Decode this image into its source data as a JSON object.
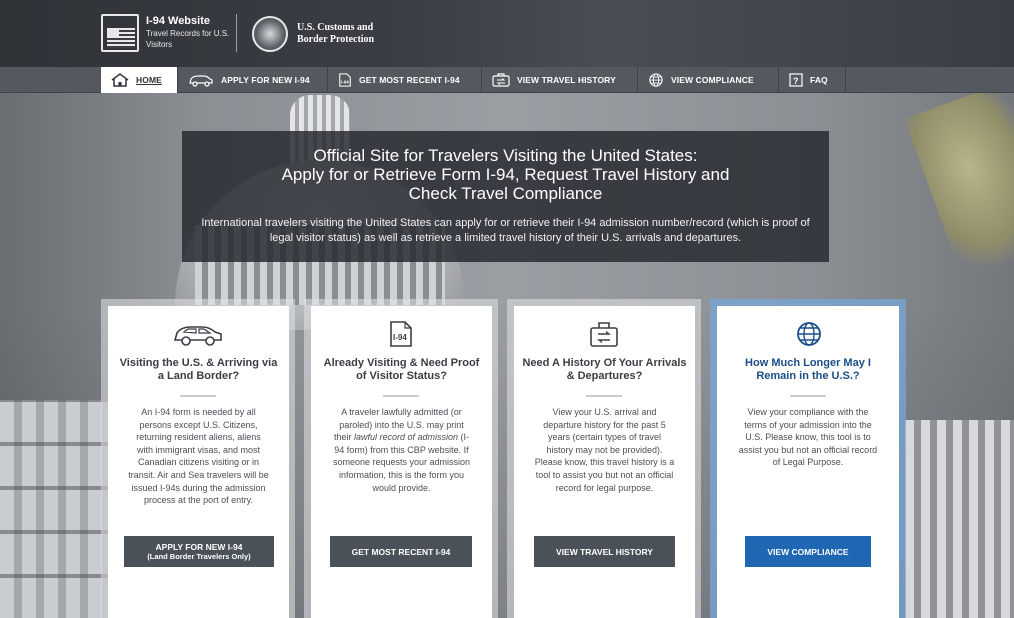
{
  "header": {
    "brand_title": "I-94 Website",
    "brand_sub": "Travel Records for U.S. Visitors",
    "agency_name": "U.S. Customs and Border Protection"
  },
  "nav": {
    "items": [
      {
        "label": "HOME",
        "icon": "home-icon",
        "active": true
      },
      {
        "label": "APPLY FOR NEW I-94",
        "icon": "car-icon"
      },
      {
        "label": "GET MOST RECENT I-94",
        "icon": "i94-document-icon"
      },
      {
        "label": "VIEW TRAVEL HISTORY",
        "icon": "travel-history-icon"
      },
      {
        "label": "VIEW COMPLIANCE",
        "icon": "globe-icon"
      },
      {
        "label": "FAQ",
        "icon": "question-icon"
      }
    ]
  },
  "hero": {
    "title": "Official Site for Travelers Visiting the United States:\nApply for or Retrieve Form I-94, Request Travel History and\nCheck Travel Compliance",
    "description": "International travelers visiting the United States can apply for or retrieve their I-94 admission number/record (which is proof of legal visitor status) as well as retrieve a limited travel history of their U.S. arrivals and departures."
  },
  "cards": [
    {
      "icon": "car-icon",
      "title": "Visiting the U.S. & Arriving via a Land Border?",
      "body": "An I-94 form is needed by all persons except U.S. Citizens, returning resident aliens, aliens with immigrant visas, and most Canadian citizens visiting or in transit. Air and Sea travelers will be issued I-94s during the admission process at the port of entry.",
      "button": "APPLY FOR NEW I-94",
      "button_sub": "(Land Border Travelers Only)"
    },
    {
      "icon": "i94-document-icon",
      "title": "Already Visiting & Need Proof of Visitor Status?",
      "body_pre": "A traveler lawfully admitted (or paroled) into the U.S. may print their ",
      "body_em": "lawful record of admission",
      "body_post": " (I-94 form) from this CBP website. If someone requests your admission information, this is the form you would provide.",
      "button": "GET MOST RECENT I-94"
    },
    {
      "icon": "travel-history-icon",
      "title": "Need A History Of Your Arrivals & Departures?",
      "body": "View your U.S. arrival and departure history for the past 5 years (certain types of travel history may not be provided). Please know, this travel history is a tool to assist you but not an official record for legal purpose.",
      "button": "VIEW TRAVEL HISTORY"
    },
    {
      "icon": "globe-icon",
      "title": "How Much Longer May I Remain in the U.S.?",
      "body": "View your compliance with the terms of your admission into the U.S. Please know, this tool is to assist you but not an official record of Legal Purpose.",
      "button": "VIEW COMPLIANCE"
    }
  ],
  "colors": {
    "header_bg": "#3b3f45",
    "nav_bg": "#54595f",
    "button_dark": "#4a5158",
    "button_blue": "#1f66b3",
    "title_blue": "#1a4f86"
  }
}
